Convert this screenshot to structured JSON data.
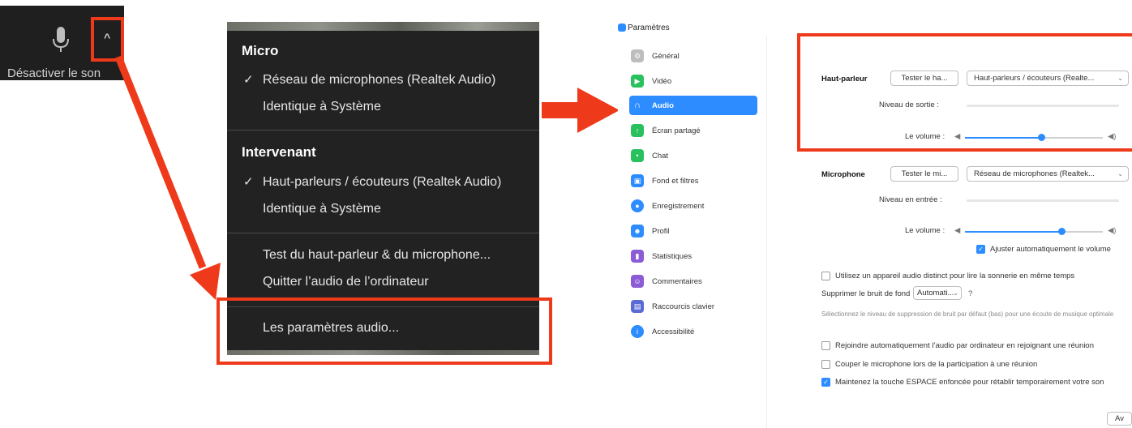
{
  "mute_control": {
    "label": "Désactiver le son",
    "caret": "^"
  },
  "audio_menu": {
    "micro_heading": "Micro",
    "micro_items": [
      {
        "label": "Réseau de microphones (Realtek Audio)",
        "checked": true
      },
      {
        "label": "Identique à Système",
        "checked": false
      }
    ],
    "speaker_heading": "Intervenant",
    "speaker_items": [
      {
        "label": "Haut-parleurs / écouteurs (Realtek Audio)",
        "checked": true
      },
      {
        "label": "Identique à Système",
        "checked": false
      }
    ],
    "test_label": "Test du haut-parleur & du microphone...",
    "leave_label": "Quitter l’audio de l’ordinateur",
    "settings_label": "Les paramètres audio...",
    "check_glyph": "✓"
  },
  "settings_window": {
    "title": "Paramètres",
    "sidebar": [
      {
        "label": "Général",
        "icon": "gear-icon",
        "color": "#bdbdbd"
      },
      {
        "label": "Vidéo",
        "icon": "video-icon",
        "color": "#29c05e"
      },
      {
        "label": "Audio",
        "icon": "headphones-icon",
        "color": "#ffffff"
      },
      {
        "label": "Écran partagé",
        "icon": "share-screen-icon",
        "color": "#29c05e"
      },
      {
        "label": "Chat",
        "icon": "chat-icon",
        "color": "#29c05e"
      },
      {
        "label": "Fond et filtres",
        "icon": "background-icon",
        "color": "#2d8cff"
      },
      {
        "label": "Enregistrement",
        "icon": "recording-icon",
        "color": "#2d8cff"
      },
      {
        "label": "Profil",
        "icon": "profile-icon",
        "color": "#2d8cff"
      },
      {
        "label": "Statistiques",
        "icon": "statistics-icon",
        "color": "#8b5cd6"
      },
      {
        "label": "Commentaires",
        "icon": "feedback-icon",
        "color": "#8b5cd6"
      },
      {
        "label": "Raccourcis clavier",
        "icon": "keyboard-icon",
        "color": "#5b6bd6"
      },
      {
        "label": "Accessibilité",
        "icon": "accessibility-icon",
        "color": "#2d8cff"
      }
    ],
    "speaker": {
      "label": "Haut-parleur",
      "test_button": "Tester le ha...",
      "device": "Haut-parleurs / écouteurs (Realte...",
      "output_level_label": "Niveau de sortie :",
      "volume_label": "Le volume :",
      "volume_fraction": 0.55
    },
    "microphone": {
      "label": "Microphone",
      "test_button": "Tester le mi...",
      "device": "Réseau de microphones (Realtek...",
      "input_level_label": "Niveau en entrée :",
      "volume_label": "Le volume :",
      "volume_fraction": 0.7,
      "auto_adjust_label": "Ajuster automatiquement le volume",
      "auto_adjust_checked": true
    },
    "ringtone_label": "Utilisez un appareil audio distinct pour lire la sonnerie en même temps",
    "noise_label": "Supprimer le bruit de fond",
    "noise_value": "Automati...",
    "noise_help": "Sélectionnez le niveau de suppression de bruit par défaut (bas) pour une écoute de musique optimale",
    "options": [
      {
        "label": "Rejoindre automatiquement l’audio par ordinateur en rejoignant une réunion",
        "checked": false
      },
      {
        "label": "Couper le microphone lors de la participation à une réunion",
        "checked": false
      },
      {
        "label": "Maintenez la touche ESPACE enfoncée pour rétablir temporairement votre son",
        "checked": true
      }
    ],
    "advanced_button": "Av",
    "accent_color": "#2d8cff"
  },
  "annotation_color": "#ee3a1a"
}
